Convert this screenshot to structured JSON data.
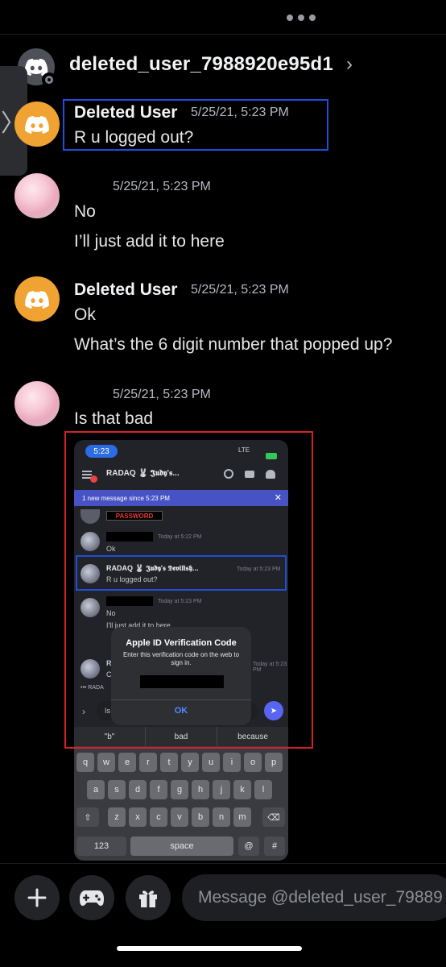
{
  "header": {
    "title": "deleted_user_7988920e95d1",
    "chevron": "›",
    "more_icon": "more-dots-icon",
    "avatar_icon": "discord-logo-icon"
  },
  "side_tab": {
    "glyph": "〉"
  },
  "messages": [
    {
      "author": "Deleted User",
      "time": "5/25/21, 5:23 PM",
      "lines": [
        "R u logged out?"
      ],
      "avatar": "discord-logo"
    },
    {
      "author": "",
      "time": "5/25/21, 5:23 PM",
      "lines": [
        "No",
        "I’ll just add it to here"
      ],
      "avatar": "anime-avatar"
    },
    {
      "author": "Deleted User",
      "time": "5/25/21, 5:23 PM",
      "lines": [
        "Ok",
        "What’s the 6 digit number that popped up?"
      ],
      "avatar": "discord-logo"
    },
    {
      "author": "",
      "time": "5/25/21, 5:23 PM",
      "lines": [
        "Is that bad"
      ],
      "avatar": "anime-avatar"
    }
  ],
  "screenshot": {
    "status_time": "5:23",
    "status_right": "LTE",
    "channel_title": "RADAQ 🐰 𝕵𝖚𝖉𝖞'𝖘...",
    "banner": "1 new message since 5:23 PM",
    "banner_close": "✕",
    "password_label": "PASSWORD",
    "rows": [
      {
        "time": "Today at 5:22 PM",
        "text": "Ok"
      },
      {
        "author": "RADAQ 🐰 𝕵𝖚𝖉𝖞'𝖘 𝕯𝖊𝖛𝖎𝖑𝖎𝖘𝖍...",
        "time": "Today at 5:23 PM",
        "text": "R u logged out?"
      },
      {
        "time": "Today at 5:23 PM",
        "text": "No",
        "text2": "I'll just add it to here"
      },
      {
        "time": "Today at 5:23 PM",
        "text": "R",
        "text2": "C"
      }
    ],
    "typing": "••• RADA",
    "input_text": "Is",
    "alert": {
      "title": "Apple ID Verification Code",
      "body": "Enter this verification code on the web to sign in.",
      "ok": "OK"
    },
    "suggestions": [
      "\"b\"",
      "bad",
      "because"
    ],
    "keyboard": {
      "row1": [
        "q",
        "w",
        "e",
        "r",
        "t",
        "y",
        "u",
        "i",
        "o",
        "p"
      ],
      "row2": [
        "a",
        "s",
        "d",
        "f",
        "g",
        "h",
        "j",
        "k",
        "l"
      ],
      "row3": [
        "z",
        "x",
        "c",
        "v",
        "b",
        "n",
        "m"
      ],
      "numbers": "123",
      "space": "space",
      "at": "@",
      "hash": "#"
    }
  },
  "composer": {
    "placeholder": "Message @deleted_user_79889",
    "buttons": [
      "plus-icon",
      "gamepad-icon",
      "gift-icon"
    ]
  },
  "colors": {
    "background": "#000000",
    "discord_orange": "#f0a232",
    "highlight_blue": "#1f4fd6",
    "highlight_red": "#d32226",
    "blurple": "#4752c4"
  }
}
